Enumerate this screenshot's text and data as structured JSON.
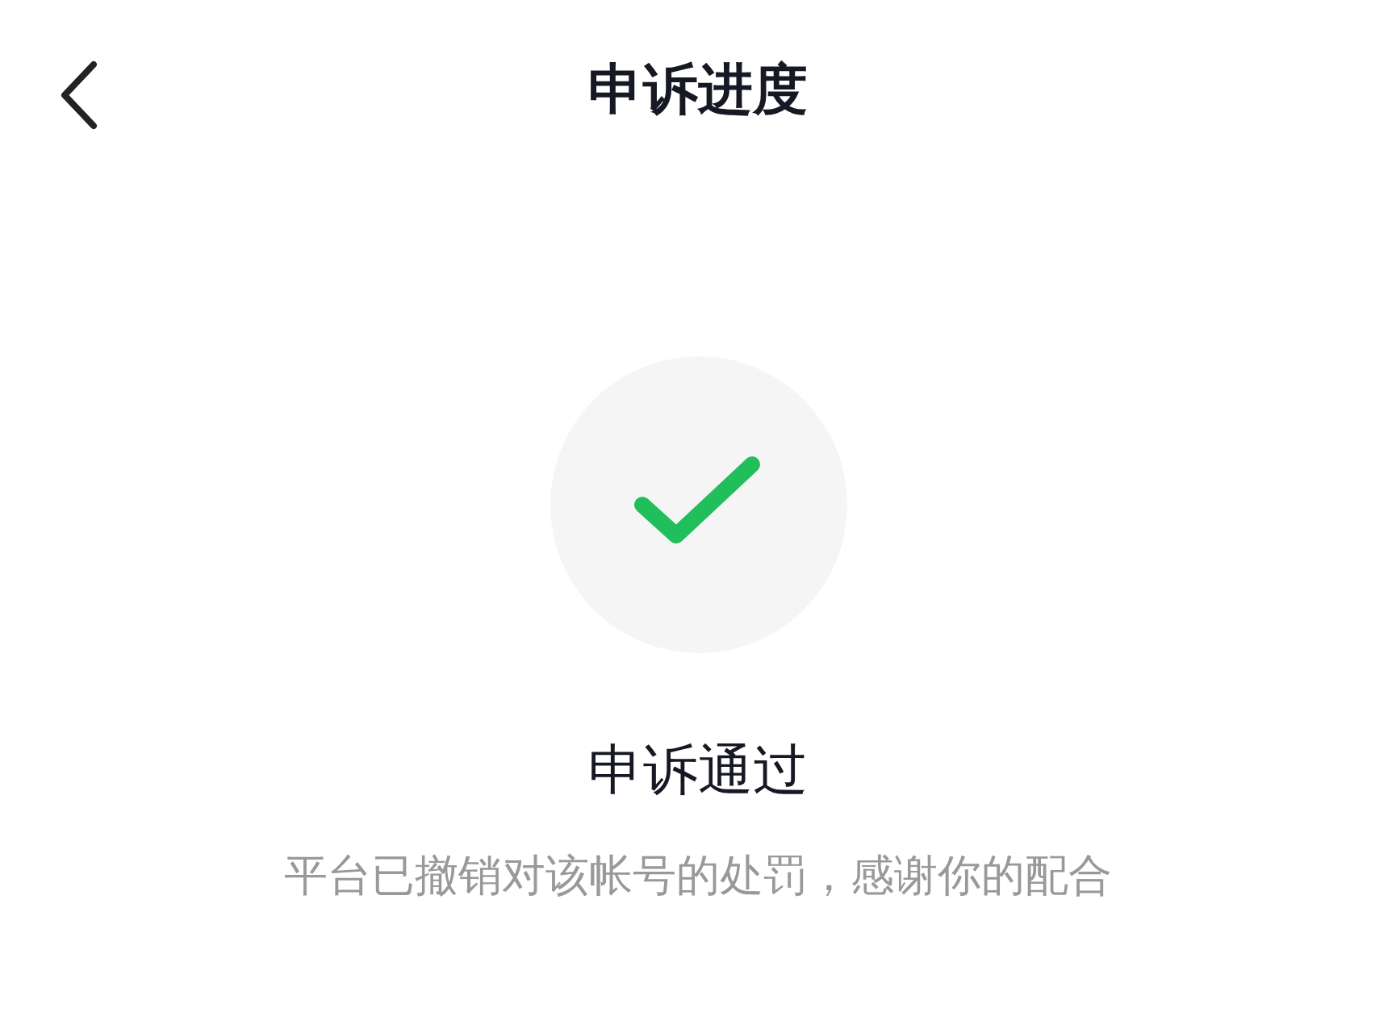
{
  "header": {
    "title": "申诉进度"
  },
  "result": {
    "kind": "success",
    "title": "申诉通过",
    "message": "平台已撤销对该帐号的处罚，感谢你的配合"
  }
}
